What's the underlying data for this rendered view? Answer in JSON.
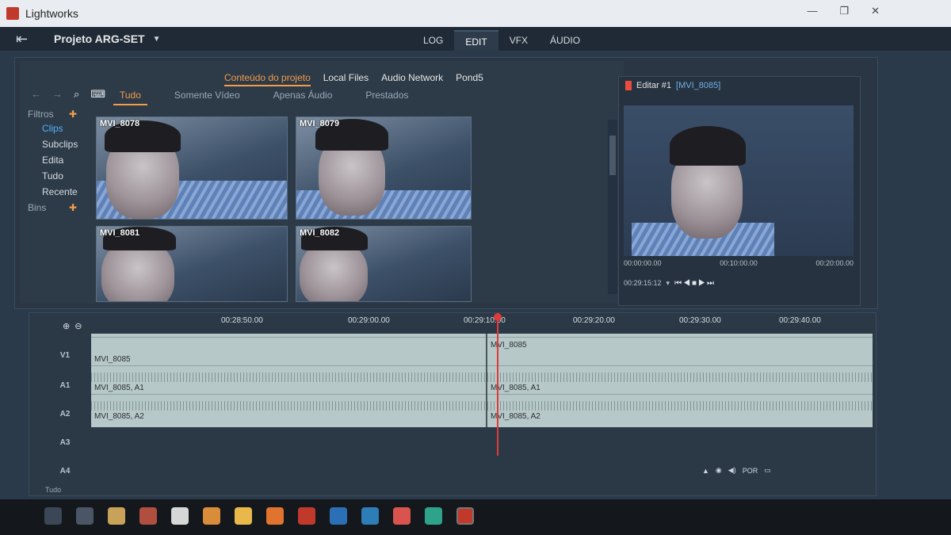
{
  "window": {
    "title": "Lightworks"
  },
  "header": {
    "project_name": "Projeto ARG-SET",
    "mode_tabs": [
      "LOG",
      "EDIT",
      "VFX",
      "ÁUDIO"
    ]
  },
  "browser": {
    "source_tabs": [
      "Conteúdo do projeto",
      "Local Files",
      "Audio Network",
      "Pond5"
    ],
    "sub_tabs": [
      "Tudo",
      "Somente Vídeo",
      "Apenas Áudio",
      "Prestados"
    ],
    "filters_label": "Filtros",
    "filter_items": [
      "Clips",
      "Subclips",
      "Edita",
      "Tudo",
      "Recente"
    ],
    "bins_label": "Bins",
    "clips": [
      "MVI_8078",
      "MVI_8079",
      "MVI_8081",
      "MVI_8082"
    ]
  },
  "viewer": {
    "title": "Editar #1",
    "clip": "[MVI_8085]",
    "ruler": [
      "00:00:00.00",
      "00:10:00.00",
      "00:20:00.00"
    ],
    "timecode": "00:29:15:12"
  },
  "timeline": {
    "ruler": [
      "00:28:50.00",
      "00:29:00.00",
      "00:29:10.00",
      "00:29:20.00",
      "00:29:30.00",
      "00:29:40.00"
    ],
    "tracks": [
      "V1",
      "A1",
      "A2",
      "A3",
      "A4"
    ],
    "clip_labels": {
      "v1_left": "MVI_8085",
      "v1_right": "MVI_8085",
      "a1_left": "MVI_8085, A1",
      "a1_right": "MVI_8085, A1",
      "a2_left": "MVI_8085, A2",
      "a2_right": "MVI_8085, A2"
    },
    "footer": "Tudo"
  },
  "tray": {
    "lang": "POR"
  },
  "colors": {
    "accent": "#f39c4a",
    "playhead": "#e03b3b",
    "selected_filter": "#4fb3ff"
  }
}
